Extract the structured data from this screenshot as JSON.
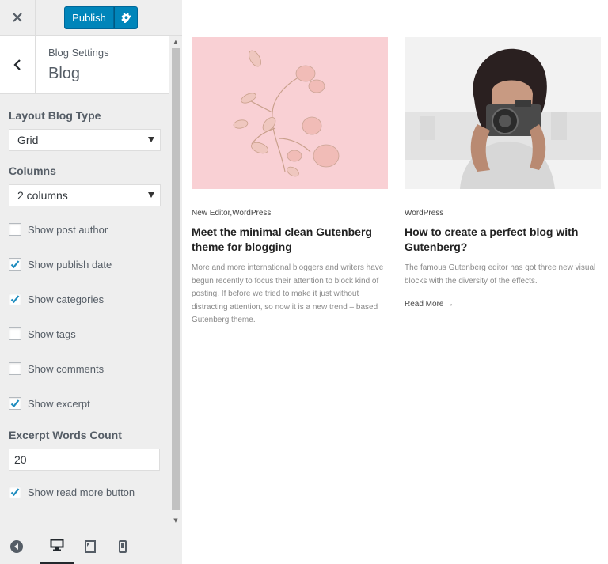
{
  "toolbar": {
    "close_icon": "close-icon",
    "publish_label": "Publish",
    "settings_icon": "gear-icon",
    "accent": "#0085ba"
  },
  "section": {
    "breadcrumb": "Blog Settings",
    "title": "Blog"
  },
  "controls": {
    "layout_label": "Layout Blog Type",
    "layout_value": "Grid",
    "columns_label": "Columns",
    "columns_value": "2 columns",
    "checkboxes": [
      {
        "label": "Show post author",
        "checked": false
      },
      {
        "label": "Show publish date",
        "checked": true
      },
      {
        "label": "Show categories",
        "checked": true
      },
      {
        "label": "Show tags",
        "checked": false
      },
      {
        "label": "Show comments",
        "checked": false
      },
      {
        "label": "Show excerpt",
        "checked": true
      }
    ],
    "excerpt_count_label": "Excerpt Words Count",
    "excerpt_count_value": "20",
    "read_more": {
      "label": "Show read more button",
      "checked": true
    }
  },
  "footer": {
    "collapse_icon": "collapse-icon",
    "desktop_icon": "desktop-icon",
    "tablet_icon": "tablet-icon",
    "mobile_icon": "mobile-icon",
    "active_device": "desktop"
  },
  "posts": [
    {
      "categories": "New Editor,WordPress",
      "title": "Meet the minimal clean Gutenberg theme for blogging",
      "excerpt": "More and more international bloggers and writers have begun recently to focus their attention to block kind of posting. If before we tried to make it just without distracting attention, so now it is a new trend – based Gutenberg theme.",
      "read_more": ""
    },
    {
      "categories": "WordPress",
      "title": "How to create a perfect blog with Gutenberg?",
      "excerpt": "The famous Gutenberg editor has got three new visual blocks with the diversity of the effects.",
      "read_more": "Read More →"
    }
  ]
}
